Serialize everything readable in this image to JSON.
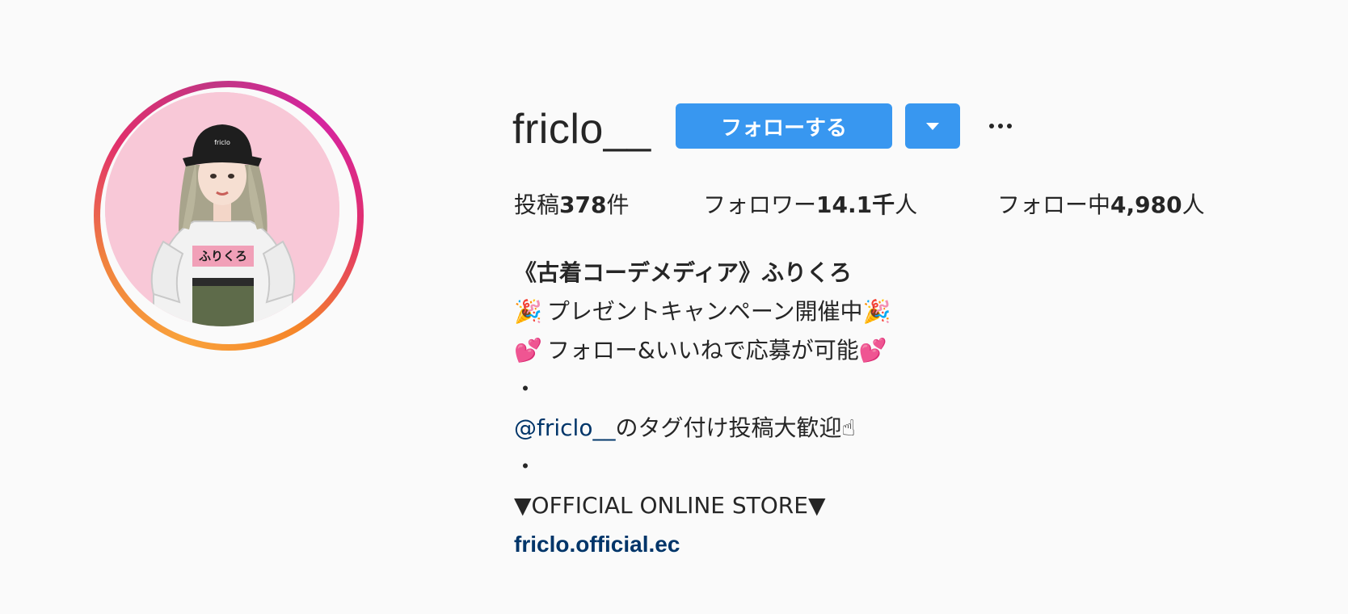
{
  "profile": {
    "username": "friclo__",
    "follow_label": "フォローする",
    "more_label": "...",
    "avatar_text": "ふりくろ",
    "hat_text": "friclo"
  },
  "stats": {
    "posts_prefix": "投稿",
    "posts_count": "378",
    "posts_suffix": "件",
    "followers_prefix": "フォロワー",
    "followers_count": "14.1千",
    "followers_suffix": "人",
    "following_prefix": "フォロー中",
    "following_count": "4,980",
    "following_suffix": "人"
  },
  "bio": {
    "name": "《古着コーデメディア》ふりくろ",
    "line1_emoji_left": "🎉",
    "line1_text": "プレゼントキャンペーン開催中",
    "line1_emoji_right": "🎉",
    "line2_emoji_left": "💕",
    "line2_text": "フォロー&いいねで応募が可能",
    "line2_emoji_right": "💕",
    "dot1": "・",
    "mention": "@friclo__",
    "line3_text": "のタグ付け投稿大歓迎",
    "line3_emoji": "☝",
    "dot2": "・",
    "store_label": "▼OFFICIAL ONLINE STORE▼",
    "website": "friclo.official.ec"
  },
  "colors": {
    "accent": "#3897f0",
    "link": "#003569",
    "text": "#262626",
    "background": "#fafafa",
    "avatar_bg": "#f8c8d7"
  }
}
